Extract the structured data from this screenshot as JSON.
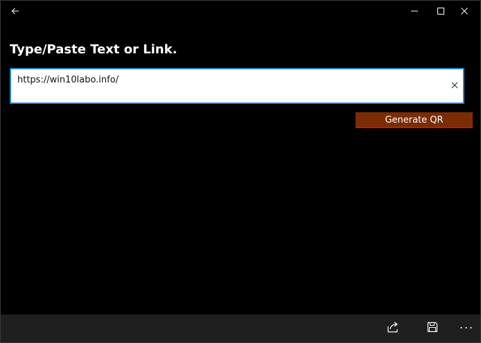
{
  "input": {
    "value": "https://win10labo.info/",
    "placeholder": ""
  },
  "main": {
    "heading": "Type/Paste Text or Link.",
    "generate_label": "Generate QR"
  },
  "icons": {
    "back": "back-arrow-icon",
    "minimize": "minimize-icon",
    "maximize": "maximize-icon",
    "close": "close-icon",
    "clear": "clear-x-icon",
    "share": "share-icon",
    "save": "floppy-save-icon",
    "more": "more-ellipsis-icon"
  },
  "colors": {
    "background": "#000000",
    "input_border": "#1f7fd6",
    "button_fill": "#7a2c05",
    "button_underline": "#d01010",
    "commandbar": "#1f1f1f"
  },
  "commandbar": {
    "more_glyph": "···"
  }
}
